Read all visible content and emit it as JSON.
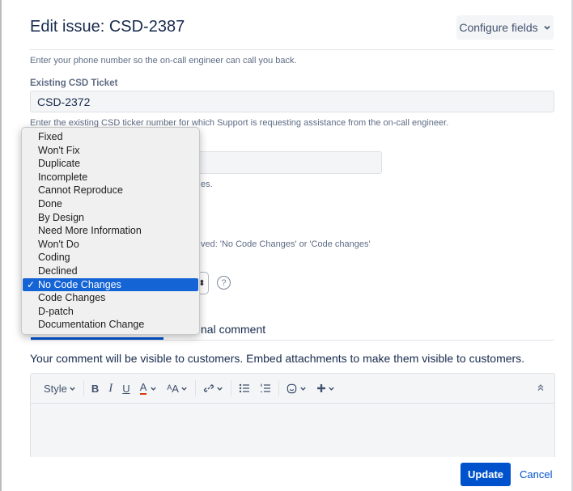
{
  "dialog": {
    "title": "Edit issue: CSD-2387",
    "configure_label": "Configure fields",
    "configure_icon": "chevron-down-icon"
  },
  "fields": {
    "phone_help": "Enter your phone number so the on-call engineer can call you back.",
    "ticket_label": "Existing CSD Ticket",
    "ticket_value": "CSD-2372",
    "ticket_help": "Enter the existing CSD ticker number for which Support is requesting assistance from the on-call engineer.",
    "partial_help_1": "es.",
    "partial_help_2": "ved: 'No Code Changes' or 'Code changes'",
    "help_icon_glyph": "?"
  },
  "resolution_dropdown": {
    "options": [
      "Fixed",
      "Won't Fix",
      "Duplicate",
      "Incomplete",
      "Cannot Reproduce",
      "Done",
      "By Design",
      "Need More Information",
      "Won't Do",
      "Coding",
      "Declined",
      "No Code Changes",
      "Code Changes",
      "D-patch",
      "Documentation Change"
    ],
    "selected": "No Code Changes",
    "check_glyph": "✓",
    "select_arrows_glyph": "⬍"
  },
  "comment": {
    "internal_tab_label": "nal comment",
    "visibility_note": "Your comment will be visible to customers. Embed attachments to make them visible to customers."
  },
  "toolbar": {
    "style_label": "Style",
    "bold": "B",
    "italic": "I",
    "underline": "U",
    "text_color": "A",
    "text_size": "ᴬA",
    "link": "🔗",
    "bullet_list": "☰",
    "numbered_list": "☷",
    "emoji": "☺",
    "insert": "✚",
    "collapse": "︽"
  },
  "actions": {
    "update_label": "Update",
    "cancel_label": "Cancel"
  },
  "colors": {
    "primary": "#0052cc",
    "selected_option": "#1464d6",
    "text_red_underline": "#de350b"
  }
}
